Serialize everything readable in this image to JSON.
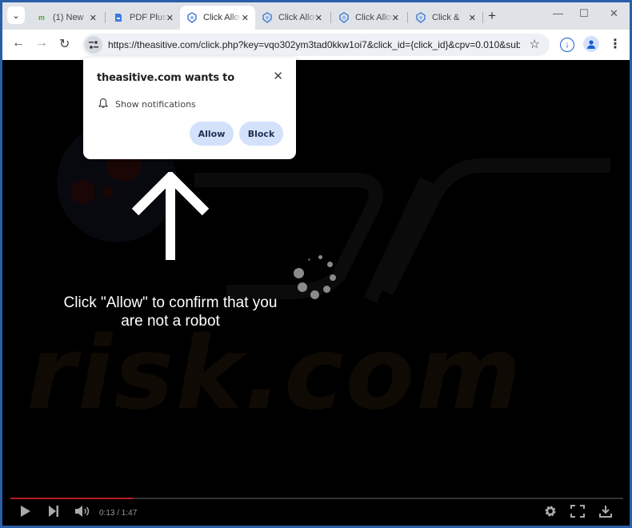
{
  "browser": {
    "tabs": [
      {
        "title": "(1) New",
        "icon": "m-leaf-icon",
        "active": false
      },
      {
        "title": "PDF Plus",
        "icon": "pdf-icon",
        "active": false
      },
      {
        "title": "Click Allow",
        "icon": "shield-icon",
        "active": true
      },
      {
        "title": "Click Allow",
        "icon": "shield-icon",
        "active": false
      },
      {
        "title": "Click Allow",
        "icon": "shield-icon",
        "active": false
      },
      {
        "title": "Click &",
        "icon": "shield-icon",
        "active": false
      }
    ],
    "tab_close_glyph": "✕",
    "new_tab_glyph": "+",
    "tab_search_glyph": "⌄",
    "window_controls": {
      "minimize": "—",
      "maximize": "☐",
      "close": "✕"
    },
    "nav": {
      "back": "←",
      "forward": "→",
      "reload": "↻"
    },
    "url": "https://theasitive.com/click.php?key=vqo302ym3tad0kkw1oi7&click_id={click_id}&cpv=0.010&subi...",
    "star_glyph": "☆",
    "menu_glyph": "⋮",
    "download_glyph": "↓",
    "profile_glyph": "👤"
  },
  "popup": {
    "title": "theasitive.com wants to",
    "close_glyph": "✕",
    "permission": "Show notifications",
    "allow_label": "Allow",
    "block_label": "Block"
  },
  "page": {
    "message_line1": "Click \"Allow\" to confirm that you",
    "message_line2": "are not a robot",
    "watermark": "risk.com"
  },
  "video": {
    "current_time": "0:13",
    "duration": "1:47",
    "time_display": "0:13 / 1:47",
    "progress_fraction": 0.2,
    "play_glyph": "▶",
    "next_glyph": "⏭",
    "volume_glyph": "🔊",
    "settings_glyph": "⚙",
    "fullscreen_glyph": "⛶",
    "download_glyph": "⤓",
    "accent": "#b81d1d"
  }
}
